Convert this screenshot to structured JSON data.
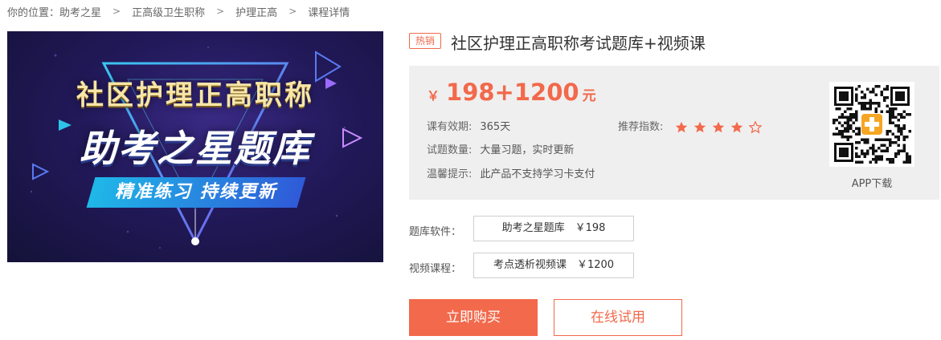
{
  "breadcrumb": {
    "prefix": "你的位置：",
    "items": [
      "助考之星",
      "正高级卫生职称",
      "护理正高",
      "课程详情"
    ],
    "separator": ">"
  },
  "banner": {
    "line1": "社区护理正高职称",
    "line2": "助考之星题库",
    "line3": "精准练习 持续更新"
  },
  "product": {
    "badge": "热销",
    "title": "社区护理正高职称考试题库+视频课"
  },
  "price": {
    "currency": "￥",
    "amount": "198+1200",
    "unit": "元"
  },
  "details": {
    "validity_label": "课有效期:",
    "validity_value": "365天",
    "quantity_label": "试题数量:",
    "quantity_value": "大量习题，实时更新",
    "notice_label": "温馨提示:",
    "notice_value": "此产品不支持学习卡支付",
    "rating_label": "推荐指数:",
    "rating_value": 4,
    "rating_max": 5
  },
  "app": {
    "label": "APP下载"
  },
  "options": [
    {
      "label": "题库软件：",
      "value": "助考之星题库　￥198"
    },
    {
      "label": "视频课程：",
      "value": "考点透析视频课　￥1200"
    }
  ],
  "actions": {
    "buy": "立即购买",
    "trial": "在线试用"
  },
  "colors": {
    "accent": "#f2694b",
    "panel_bg": "#efefef"
  }
}
